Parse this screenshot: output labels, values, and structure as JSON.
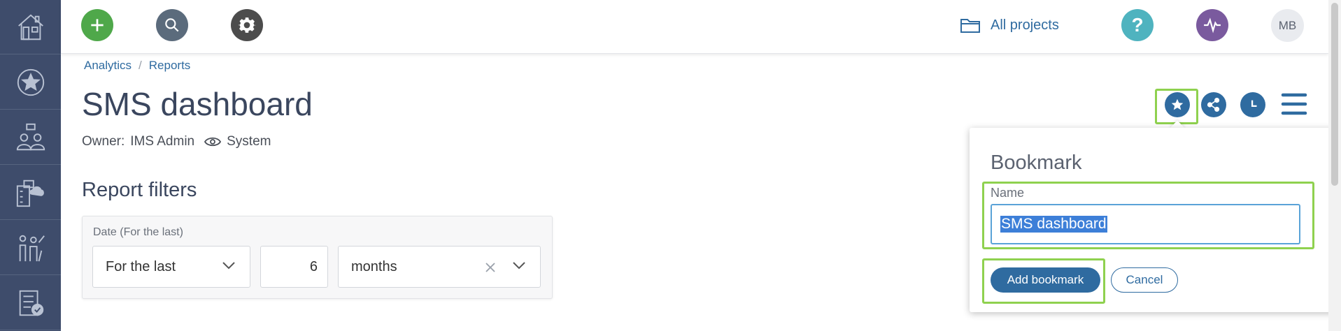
{
  "sidebar": {
    "items": [
      {
        "icon": "home-icon"
      },
      {
        "icon": "star-icon"
      },
      {
        "icon": "people-chat-icon"
      },
      {
        "icon": "building-cloud-icon"
      },
      {
        "icon": "family-icon"
      },
      {
        "icon": "checklist-icon"
      }
    ]
  },
  "topbar": {
    "add_icon": "plus-icon",
    "search_icon": "search-icon",
    "settings_icon": "gear-icon",
    "projects_label": "All projects",
    "help_icon": "question-icon",
    "activity_icon": "pulse-icon",
    "avatar_initials": "MB",
    "colors": {
      "add": "#4fa84a",
      "search": "#5b6b7c",
      "settings": "#4c4c4c",
      "help": "#4fb3bf",
      "activity": "#7a5a9e"
    }
  },
  "breadcrumb": {
    "items": [
      "Analytics",
      "Reports"
    ],
    "separator": "/"
  },
  "page": {
    "title": "SMS dashboard",
    "owner_label": "Owner:",
    "owner_name": "IMS Admin",
    "visibility": "System"
  },
  "filters": {
    "section_title": "Report filters",
    "date_label": "Date (For the last)",
    "mode_value": "For the last",
    "amount_value": "6",
    "unit_value": "months"
  },
  "toolbar": {
    "bookmark_icon": "star-icon",
    "share_icon": "share-icon",
    "history_icon": "clock-icon",
    "menu_icon": "hamburger-menu-icon"
  },
  "bookmark_popover": {
    "title": "Bookmark",
    "name_label": "Name",
    "name_value": "SMS dashboard",
    "add_button": "Add bookmark",
    "cancel_button": "Cancel"
  }
}
